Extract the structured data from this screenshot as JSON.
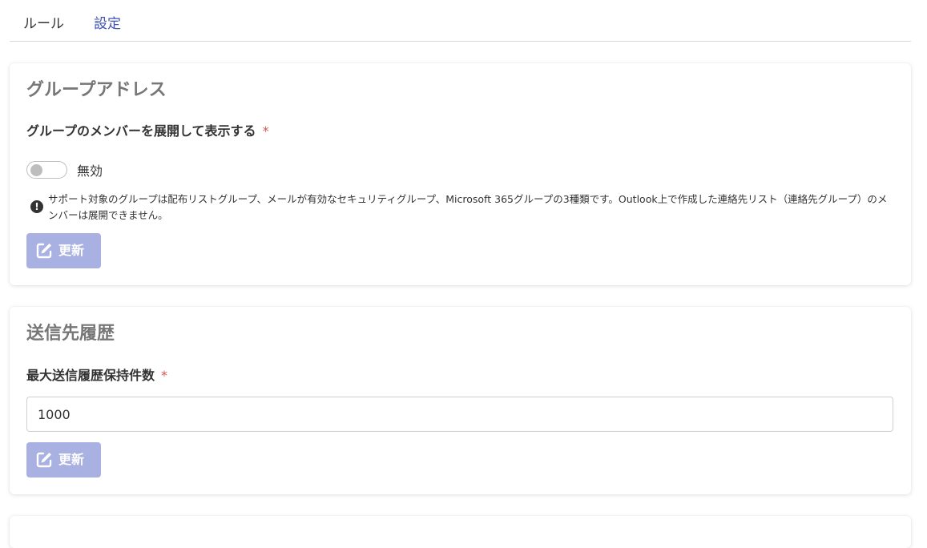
{
  "tabs": {
    "rules": "ルール",
    "settings": "設定"
  },
  "group_address": {
    "title": "グループアドレス",
    "field_label": "グループのメンバーを展開して表示する",
    "required_mark": "*",
    "toggle_state_label": "無効",
    "note": "サポート対象のグループは配布リストグループ、メールが有効なセキュリティグループ、Microsoft 365グループの3種類です。Outlook上で作成した連絡先リスト（連絡先グループ）のメンバーは展開できません。",
    "update_button": "更新"
  },
  "send_history": {
    "title": "送信先履歴",
    "field_label": "最大送信履歴保持件数",
    "required_mark": "*",
    "input_value": "1000",
    "update_button": "更新"
  },
  "colors": {
    "accent": "#3f51b5",
    "button_disabled": "#a9b0e2",
    "required": "#d9534f"
  }
}
